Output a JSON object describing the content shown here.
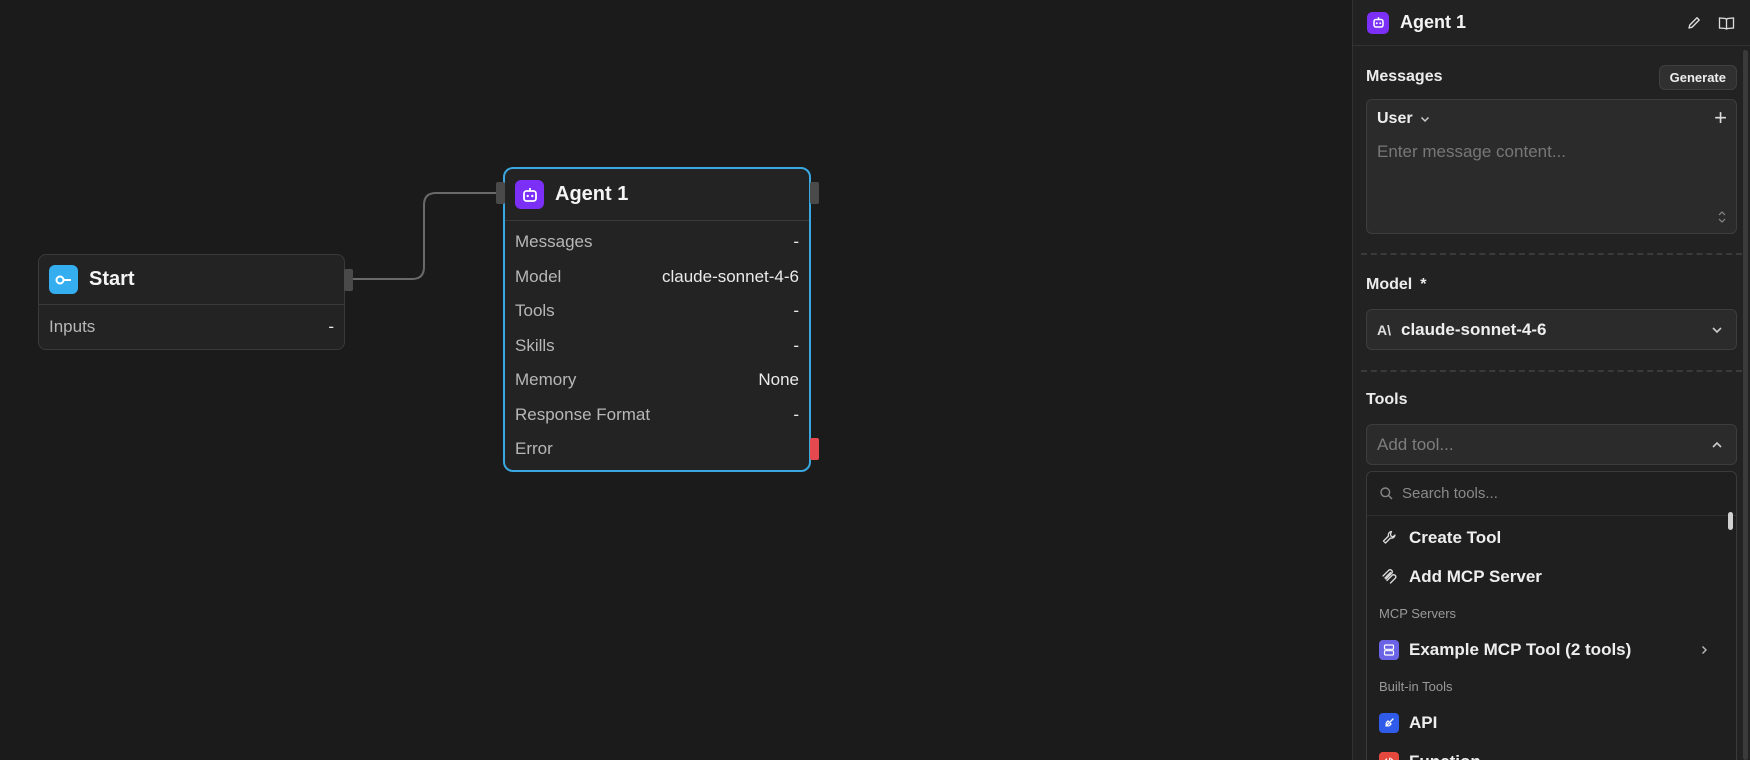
{
  "canvas": {
    "start_node": {
      "title": "Start",
      "rows": [
        {
          "label": "Inputs",
          "value": "-"
        }
      ]
    },
    "agent_node": {
      "title": "Agent 1",
      "rows": [
        {
          "label": "Messages",
          "value": "-"
        },
        {
          "label": "Model",
          "value": "claude-sonnet-4-6"
        },
        {
          "label": "Tools",
          "value": "-"
        },
        {
          "label": "Skills",
          "value": "-"
        },
        {
          "label": "Memory",
          "value": "None"
        },
        {
          "label": "Response Format",
          "value": "-"
        },
        {
          "label": "Error",
          "value": ""
        }
      ]
    }
  },
  "panel": {
    "title": "Agent 1",
    "messages": {
      "label": "Messages",
      "generate_label": "Generate",
      "role": "User",
      "placeholder": "Enter message content..."
    },
    "model": {
      "label": "Model",
      "required_mark": "*",
      "value": "claude-sonnet-4-6",
      "provider_glyph": "A\\"
    },
    "tools": {
      "label": "Tools",
      "placeholder": "Add tool...",
      "search_placeholder": "Search tools...",
      "actions": [
        "Create Tool",
        "Add MCP Server"
      ],
      "mcp_group_label": "MCP Servers",
      "mcp_servers": [
        "Example MCP Tool (2 tools)"
      ],
      "builtin_group_label": "Built-in Tools",
      "builtin": [
        "API",
        "Function"
      ]
    }
  },
  "colors": {
    "accent_blue": "#3aa7e0",
    "start_icon": "#35aef0",
    "agent_icon": "#7b2ff7",
    "error_handle": "#e5484d",
    "mcp_icon": "#6b63e6",
    "api_icon": "#2f5bea",
    "function_icon": "#e5483c"
  }
}
